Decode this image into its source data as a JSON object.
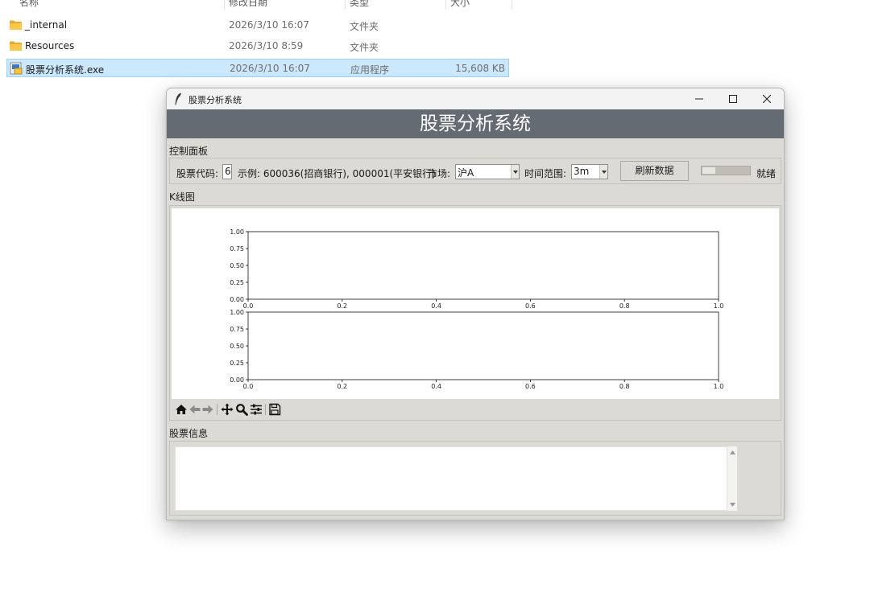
{
  "explorer": {
    "columns": {
      "name": "名称",
      "date": "修改日期",
      "type": "类型",
      "size": "大小"
    },
    "files": [
      {
        "name": "_internal",
        "date": "2026/3/10 16:07",
        "type": "文件夹",
        "size": "",
        "icon": "folder-icon"
      },
      {
        "name": "Resources",
        "date": "2026/3/10 8:59",
        "type": "文件夹",
        "size": "",
        "icon": "folder-icon"
      },
      {
        "name": "股票分析系统.exe",
        "date": "2026/3/10 16:07",
        "type": "应用程序",
        "size": "15,608 KB",
        "icon": "exe-icon",
        "selected": true
      }
    ]
  },
  "app": {
    "window_title": "股票分析系统",
    "banner_title": "股票分析系统",
    "control_panel": {
      "label": "控制面板",
      "stock_code_label": "股票代码:",
      "stock_code_value": "6",
      "example_text": "示例: 600036(招商银行), 000001(平安银行)",
      "market_label": "市场:",
      "market_value": "沪A",
      "range_label": "时间范围:",
      "range_value": "3m",
      "refresh_button": "刷新数据",
      "progress_fraction": 0.0,
      "status": "就绪"
    },
    "kline": {
      "label": "K线图",
      "toolbar": [
        "home-icon",
        "back-icon",
        "forward-icon",
        "pan-icon",
        "zoom-icon",
        "configure-icon",
        "save-icon"
      ]
    },
    "info": {
      "label": "股票信息",
      "content": ""
    }
  },
  "chart_data": [
    {
      "type": "line",
      "title": "",
      "xlabel": "",
      "ylabel": "",
      "xlim": [
        0.0,
        1.0
      ],
      "ylim": [
        0.0,
        1.0
      ],
      "xticks": [
        "0.0",
        "0.2",
        "0.4",
        "0.6",
        "0.8",
        "1.0"
      ],
      "yticks": [
        "0.00",
        "0.25",
        "0.50",
        "0.75",
        "1.00"
      ],
      "series": []
    },
    {
      "type": "bar",
      "title": "",
      "xlabel": "",
      "ylabel": "",
      "xlim": [
        0.0,
        1.0
      ],
      "ylim": [
        0.0,
        1.0
      ],
      "xticks": [
        "0.0",
        "0.2",
        "0.4",
        "0.6",
        "0.8",
        "1.0"
      ],
      "yticks": [
        "0.00",
        "0.25",
        "0.50",
        "0.75",
        "1.00"
      ],
      "series": []
    }
  ],
  "colors": {
    "banner_bg": "#656b72",
    "app_bg": "#dcdad5",
    "selection_bg": "#cce8ff",
    "folder": "#f2c250"
  }
}
